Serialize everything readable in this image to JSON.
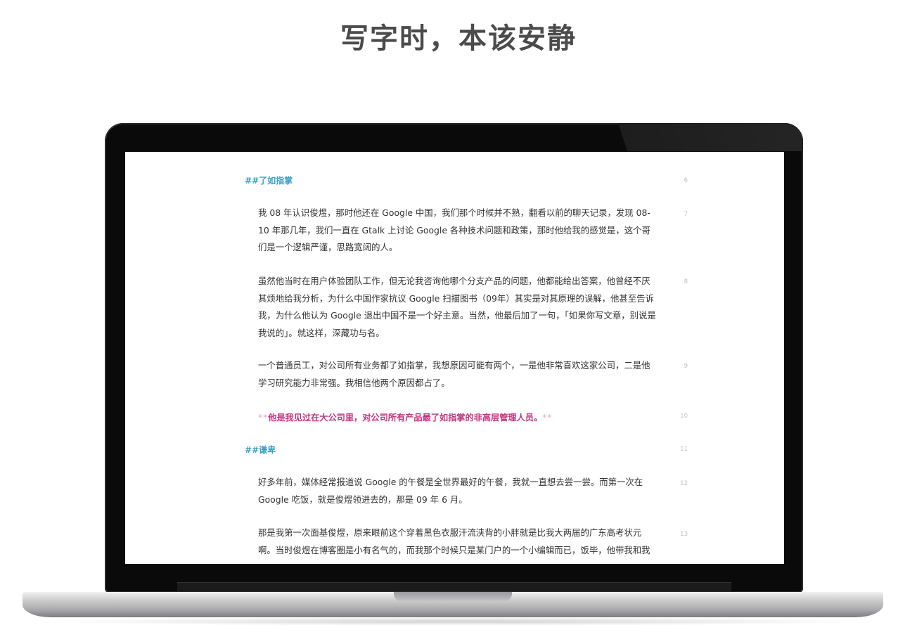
{
  "headline": "写字时，本该安静",
  "editor": {
    "lines": [
      {
        "num": "6",
        "type": "heading",
        "text": "##了如指掌"
      },
      {
        "num": "7",
        "type": "para",
        "text": "我 08 年认识俊煜，那时他还在 Google 中国，我们那个时候并不熟，翻看以前的聊天记录，发现 08-10 年那几年，我们一直在 Gtalk 上讨论 Google 各种技术问题和政策，那时他给我的感觉是，这个哥们是一个逻辑严谨，思路宽阔的人。"
      },
      {
        "num": "8",
        "type": "para",
        "text": "虽然他当时在用户体验团队工作，但无论我咨询他哪个分支产品的问题，他都能给出答案，他曾经不厌其烦地给我分析，为什么中国作家抗议 Google 扫描图书（09年）其实是对其原理的误解，他甚至告诉我，为什么他认为 Google 退出中国不是一个好主意。当然，他最后加了一句，「如果你写文章，别说是我说的」。就这样，深藏功与名。"
      },
      {
        "num": "9",
        "type": "para",
        "text": "一个普通员工，对公司所有业务都了如指掌，我想原因可能有两个，一是他非常喜欢这家公司，二是他学习研究能力非常强。我相信他两个原因都占了。"
      },
      {
        "num": "10",
        "type": "strong",
        "marker": "**",
        "text": "他是我见过在大公司里，对公司所有产品最了如指掌的非高层管理人员。"
      },
      {
        "num": "11",
        "type": "heading",
        "text": "##谦卑"
      },
      {
        "num": "12",
        "type": "para",
        "text": "好多年前，媒体经常报道说 Google 的午餐是全世界最好的午餐，我就一直想去尝一尝。而第一次在 Google 吃饭，就是俊煜领进去的，那是 09 年 6 月。"
      },
      {
        "num": "13",
        "type": "para",
        "text": "那是我第一次面基俊煜，原来眼前这个穿着黑色衣服汗流浃背的小胖就是比我大两届的广东高考状元啊。当时俊煜在博客圈是小有名气的，而我那个时候只是某门户的一个小编辑而已，饭毕，他带我和我"
      }
    ]
  }
}
